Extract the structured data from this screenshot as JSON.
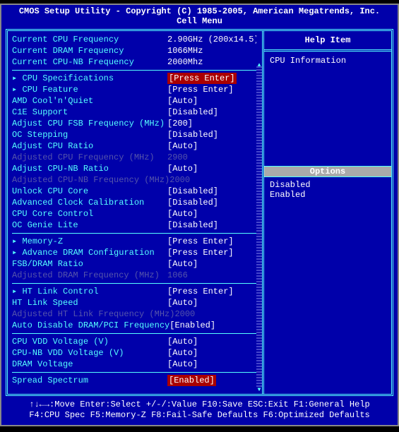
{
  "title_line1": "CMOS Setup Utility - Copyright (C) 1985-2005, American Megatrends, Inc.",
  "title_line2": "Cell Menu",
  "header_info": [
    {
      "label": "Current CPU Frequency",
      "value": "2.90GHz (200x14.5)"
    },
    {
      "label": "Current DRAM Frequency",
      "value": "1066MHz"
    },
    {
      "label": "Current CPU-NB Frequency",
      "value": "2000Mhz"
    }
  ],
  "section1": [
    {
      "label": "CPU Specifications",
      "value": "[Press Enter]",
      "arrow": true,
      "highlight": true
    },
    {
      "label": "CPU Feature",
      "value": "[Press Enter]",
      "arrow": true
    },
    {
      "label": "AMD Cool'n'Quiet",
      "value": "[Auto]"
    },
    {
      "label": "C1E Support",
      "value": "[Disabled]"
    },
    {
      "label": "Adjust CPU FSB Frequency (MHz)",
      "value": "[200]"
    },
    {
      "label": "OC Stepping",
      "value": "[Disabled]"
    },
    {
      "label": "Adjust CPU Ratio",
      "value": "[Auto]"
    },
    {
      "label": "Adjusted CPU Frequency (MHz)",
      "value": "2900",
      "dim": true
    },
    {
      "label": "Adjust CPU-NB Ratio",
      "value": "[Auto]"
    },
    {
      "label": "Adjusted CPU-NB Frequency (MHz)",
      "value": "2000",
      "dim": true
    },
    {
      "label": "Unlock CPU Core",
      "value": "[Disabled]"
    },
    {
      "label": "Advanced Clock Calibration",
      "value": "[Disabled]"
    },
    {
      "label": "CPU Core Control",
      "value": "[Auto]"
    },
    {
      "label": "OC Genie Lite",
      "value": "[Disabled]"
    }
  ],
  "section2": [
    {
      "label": "Memory-Z",
      "value": "[Press Enter]",
      "arrow": true
    },
    {
      "label": "Advance DRAM Configuration",
      "value": "[Press Enter]",
      "arrow": true
    },
    {
      "label": "FSB/DRAM Ratio",
      "value": "[Auto]"
    },
    {
      "label": "Adjusted DRAM Frequency (MHz)",
      "value": "1066",
      "dim": true
    }
  ],
  "section3": [
    {
      "label": "HT Link Control",
      "value": "[Press Enter]",
      "arrow": true
    },
    {
      "label": "HT Link Speed",
      "value": "[Auto]"
    },
    {
      "label": "Adjusted HT Link Frequency (MHz)",
      "value": "2000",
      "dim": true
    },
    {
      "label": "Auto Disable DRAM/PCI Frequency",
      "value": "[Enabled]"
    }
  ],
  "section4": [
    {
      "label": "CPU VDD Voltage (V)",
      "value": "[Auto]"
    },
    {
      "label": "CPU-NB VDD Voltage (V)",
      "value": "[Auto]"
    },
    {
      "label": "DRAM Voltage",
      "value": "[Auto]"
    }
  ],
  "section5": [
    {
      "label": "Spread Spectrum",
      "value": "[Enabled]",
      "highlight": true
    }
  ],
  "help": {
    "title": "Help Item",
    "text": "CPU Information"
  },
  "options": {
    "title": "Options",
    "items": [
      "Disabled",
      "Enabled"
    ]
  },
  "footer": {
    "line1": "↑↓←→:Move  Enter:Select  +/-/:Value  F10:Save  ESC:Exit  F1:General Help",
    "line2": "F4:CPU Spec  F5:Memory-Z  F8:Fail-Safe Defaults    F6:Optimized Defaults"
  }
}
